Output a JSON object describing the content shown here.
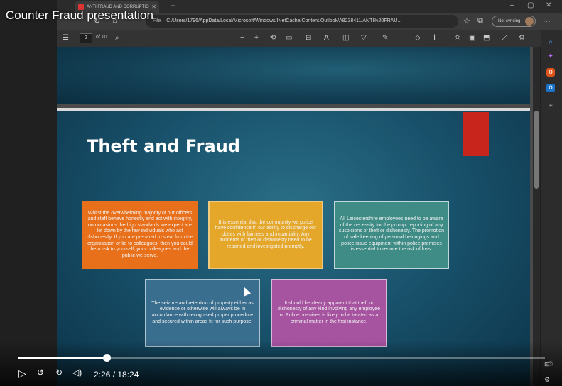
{
  "video": {
    "title": "Counter Fraud presentation",
    "current_time": "2:26",
    "total_time": "18:24",
    "time_display": "2:26 / 18:24",
    "progress_fraction": 0.168
  },
  "browser": {
    "tab_title": "ANTI FRAUD AND CORRUPTIO",
    "url_scheme_chip": "File",
    "url": "C:/Users/1796/AppData/Local/Microsoft/Windows/INetCache/Content.Outlook/A8238411/ANTI%20FRAU...",
    "sync_label": "Not syncing"
  },
  "pdf_toolbar": {
    "page_number": "2",
    "page_total": "of 10"
  },
  "slide": {
    "title": "Theft and Fraud",
    "boxes": [
      "Whilst the overwhelming majority of our officers and staff behave honestly and act with integrity, on occasions the high standards we expect are let down by the few individuals who act dishonestly. If you are prepared to steal from the organisation or lie to colleagues, then you could be a risk to yourself, your colleagues and the public we serve.",
      "It is essential that the community we police have confidence in our ability to discharge our duties with fairness and impartiality. Any incidents of theft or dishonesty need to be reported and investigated promptly.",
      "All Leicestershire employees need to be aware of the necessity for the prompt reporting of any suspicions of theft or dishonesty. The promotion of safe keeping of personal belongings and police issue equipment within police premises is essential to reduce the risk of loss.",
      "The seizure and retention of property either as evidence or otherwise will always be in accordance with recognised proper procedure and secured within areas fit for such purpose.",
      "It should be clearly apparent that theft or dishonesty of any kind involving any employee or Police premises is likely to be treated as a criminal matter in the first instance."
    ]
  },
  "colors": {
    "box_orange": "#e9701a",
    "box_yellow": "#e5a72a",
    "box_teal": "#3f8c86",
    "box_blue": "#3a6e8e",
    "box_purple": "#a653a0",
    "accent_red": "#c8261c"
  }
}
